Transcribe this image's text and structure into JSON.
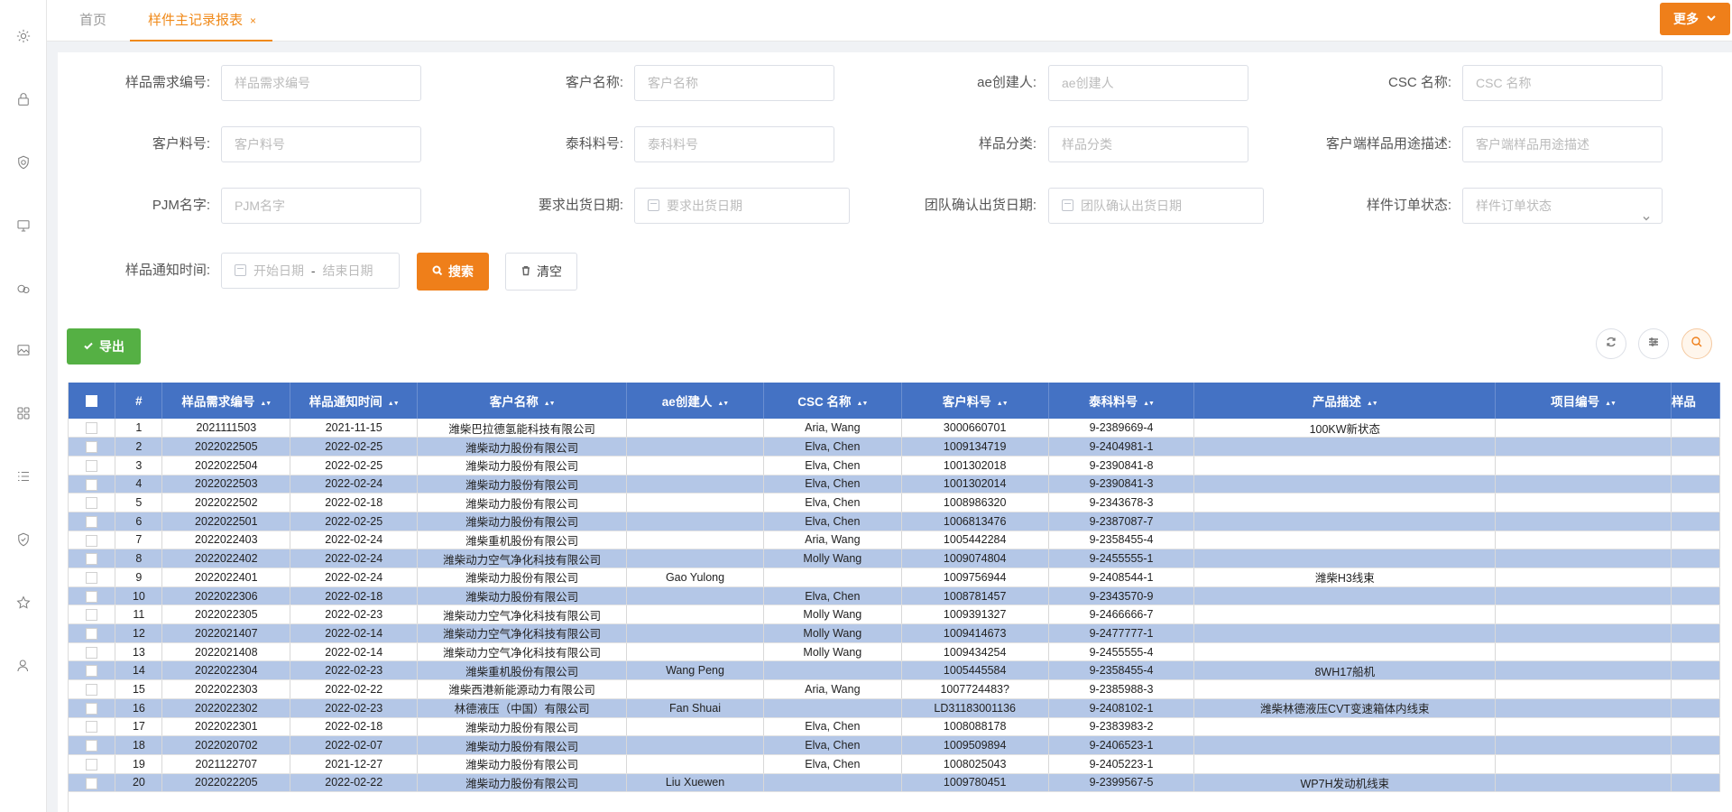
{
  "tabs": {
    "home": "首页",
    "active": "样件主记录报表",
    "close": "×"
  },
  "more_button": "更多",
  "filters": [
    {
      "key": "sample_req_no",
      "label": "样品需求编号:",
      "placeholder": "样品需求编号",
      "kind": "text"
    },
    {
      "key": "customer_name",
      "label": "客户名称:",
      "placeholder": "客户名称",
      "kind": "text"
    },
    {
      "key": "ae_creator",
      "label": "ae创建人:",
      "placeholder": "ae创建人",
      "kind": "text"
    },
    {
      "key": "csc_name",
      "label": "CSC 名称:",
      "placeholder": "CSC 名称",
      "kind": "text"
    },
    {
      "key": "customer_pn",
      "label": "客户料号:",
      "placeholder": "客户料号",
      "kind": "text"
    },
    {
      "key": "te_pn",
      "label": "泰科料号:",
      "placeholder": "泰科料号",
      "kind": "text"
    },
    {
      "key": "sample_category",
      "label": "样品分类:",
      "placeholder": "样品分类",
      "kind": "text"
    },
    {
      "key": "usage_desc",
      "label": "客户端样品用途描述:",
      "placeholder": "客户端样品用途描述",
      "kind": "text"
    },
    {
      "key": "pjm_name",
      "label": "PJM名字:",
      "placeholder": "PJM名字",
      "kind": "text"
    },
    {
      "key": "req_ship_date",
      "label": "要求出货日期:",
      "placeholder": "要求出货日期",
      "kind": "date"
    },
    {
      "key": "team_ship_date",
      "label": "团队确认出货日期:",
      "placeholder": "团队确认出货日期",
      "kind": "date"
    },
    {
      "key": "order_status",
      "label": "样件订单状态:",
      "placeholder": "样件订单状态",
      "kind": "select"
    },
    {
      "key": "notify_time",
      "label": "样品通知时间:",
      "start_placeholder": "开始日期",
      "range_sep": "-",
      "end_placeholder": "结束日期",
      "kind": "range"
    }
  ],
  "buttons": {
    "search": "搜索",
    "clear": "清空",
    "export": "导出"
  },
  "table": {
    "columns": [
      "#",
      "样品需求编号",
      "样品通知时间",
      "客户名称",
      "ae创建人",
      "CSC 名称",
      "客户料号",
      "泰科料号",
      "产品描述",
      "项目编号",
      "样品"
    ],
    "rows": [
      [
        "1",
        "2021111503",
        "2021-11-15",
        "潍柴巴拉德氢能科技有限公司",
        "",
        "Aria, Wang",
        "3000660701",
        "9-2389669-4",
        "100KW新状态",
        "",
        ""
      ],
      [
        "2",
        "2022022505",
        "2022-02-25",
        "潍柴动力股份有限公司",
        "",
        "Elva, Chen",
        "1009134719",
        "9-2404981-1",
        "",
        "",
        ""
      ],
      [
        "3",
        "2022022504",
        "2022-02-25",
        "潍柴动力股份有限公司",
        "",
        "Elva, Chen",
        "1001302018",
        "9-2390841-8",
        "",
        "",
        ""
      ],
      [
        "4",
        "2022022503",
        "2022-02-24",
        "潍柴动力股份有限公司",
        "",
        "Elva, Chen",
        "1001302014",
        "9-2390841-3",
        "",
        "",
        ""
      ],
      [
        "5",
        "2022022502",
        "2022-02-18",
        "潍柴动力股份有限公司",
        "",
        "Elva, Chen",
        "1008986320",
        "9-2343678-3",
        "",
        "",
        ""
      ],
      [
        "6",
        "2022022501",
        "2022-02-25",
        "潍柴动力股份有限公司",
        "",
        "Elva, Chen",
        "1006813476",
        "9-2387087-7",
        "",
        "",
        ""
      ],
      [
        "7",
        "2022022403",
        "2022-02-24",
        "潍柴重机股份有限公司",
        "",
        "Aria, Wang",
        "1005442284",
        "9-2358455-4",
        "",
        "",
        ""
      ],
      [
        "8",
        "2022022402",
        "2022-02-24",
        "潍柴动力空气净化科技有限公司",
        "",
        "Molly Wang",
        "1009074804",
        "9-2455555-1",
        "",
        "",
        ""
      ],
      [
        "9",
        "2022022401",
        "2022-02-24",
        "潍柴动力股份有限公司",
        "Gao Yulong",
        "",
        "1009756944",
        "9-2408544-1",
        "潍柴H3线束",
        "",
        ""
      ],
      [
        "10",
        "2022022306",
        "2022-02-18",
        "潍柴动力股份有限公司",
        "",
        "Elva, Chen",
        "1008781457",
        "9-2343570-9",
        "",
        "",
        ""
      ],
      [
        "11",
        "2022022305",
        "2022-02-23",
        "潍柴动力空气净化科技有限公司",
        "",
        "Molly Wang",
        "1009391327",
        "9-2466666-7",
        "",
        "",
        ""
      ],
      [
        "12",
        "2022021407",
        "2022-02-14",
        "潍柴动力空气净化科技有限公司",
        "",
        "Molly Wang",
        "1009414673",
        "9-2477777-1",
        "",
        "",
        ""
      ],
      [
        "13",
        "2022021408",
        "2022-02-14",
        "潍柴动力空气净化科技有限公司",
        "",
        "Molly Wang",
        "1009434254",
        "9-2455555-4",
        "",
        "",
        ""
      ],
      [
        "14",
        "2022022304",
        "2022-02-23",
        "潍柴重机股份有限公司",
        "Wang Peng",
        "",
        "1005445584",
        "9-2358455-4",
        "8WH17船机",
        "",
        ""
      ],
      [
        "15",
        "2022022303",
        "2022-02-22",
        "潍柴西港新能源动力有限公司",
        "",
        "Aria, Wang",
        "1007724483?",
        "9-2385988-3",
        "",
        "",
        ""
      ],
      [
        "16",
        "2022022302",
        "2022-02-23",
        "林德液压（中国）有限公司",
        "Fan Shuai",
        "",
        "LD31183001136",
        "9-2408102-1",
        "潍柴林德液压CVT变速箱体内线束",
        "",
        ""
      ],
      [
        "17",
        "2022022301",
        "2022-02-18",
        "潍柴动力股份有限公司",
        "",
        "Elva, Chen",
        "1008088178",
        "9-2383983-2",
        "",
        "",
        ""
      ],
      [
        "18",
        "2022020702",
        "2022-02-07",
        "潍柴动力股份有限公司",
        "",
        "Elva, Chen",
        "1009509894",
        "9-2406523-1",
        "",
        "",
        ""
      ],
      [
        "19",
        "2021122707",
        "2021-12-27",
        "潍柴动力股份有限公司",
        "",
        "Elva, Chen",
        "1008025043",
        "9-2405223-1",
        "",
        "",
        ""
      ],
      [
        "20",
        "2022022205",
        "2022-02-22",
        "潍柴动力股份有限公司",
        "Liu Xuewen",
        "",
        "1009780451",
        "9-2399567-5",
        "WP7H发动机线束",
        "",
        ""
      ]
    ]
  },
  "colors": {
    "accent": "#ef7f1a",
    "header_blue": "#4472c4",
    "row_alt": "#b4c7e7",
    "export_green": "#55b044"
  },
  "rail_icons": [
    "gear-icon",
    "lock-icon",
    "shield-clock-icon",
    "monitor-icon",
    "coins-icon",
    "image-icon",
    "grid-icon",
    "list-icon",
    "shield-icon",
    "star-icon",
    "user-icon"
  ]
}
